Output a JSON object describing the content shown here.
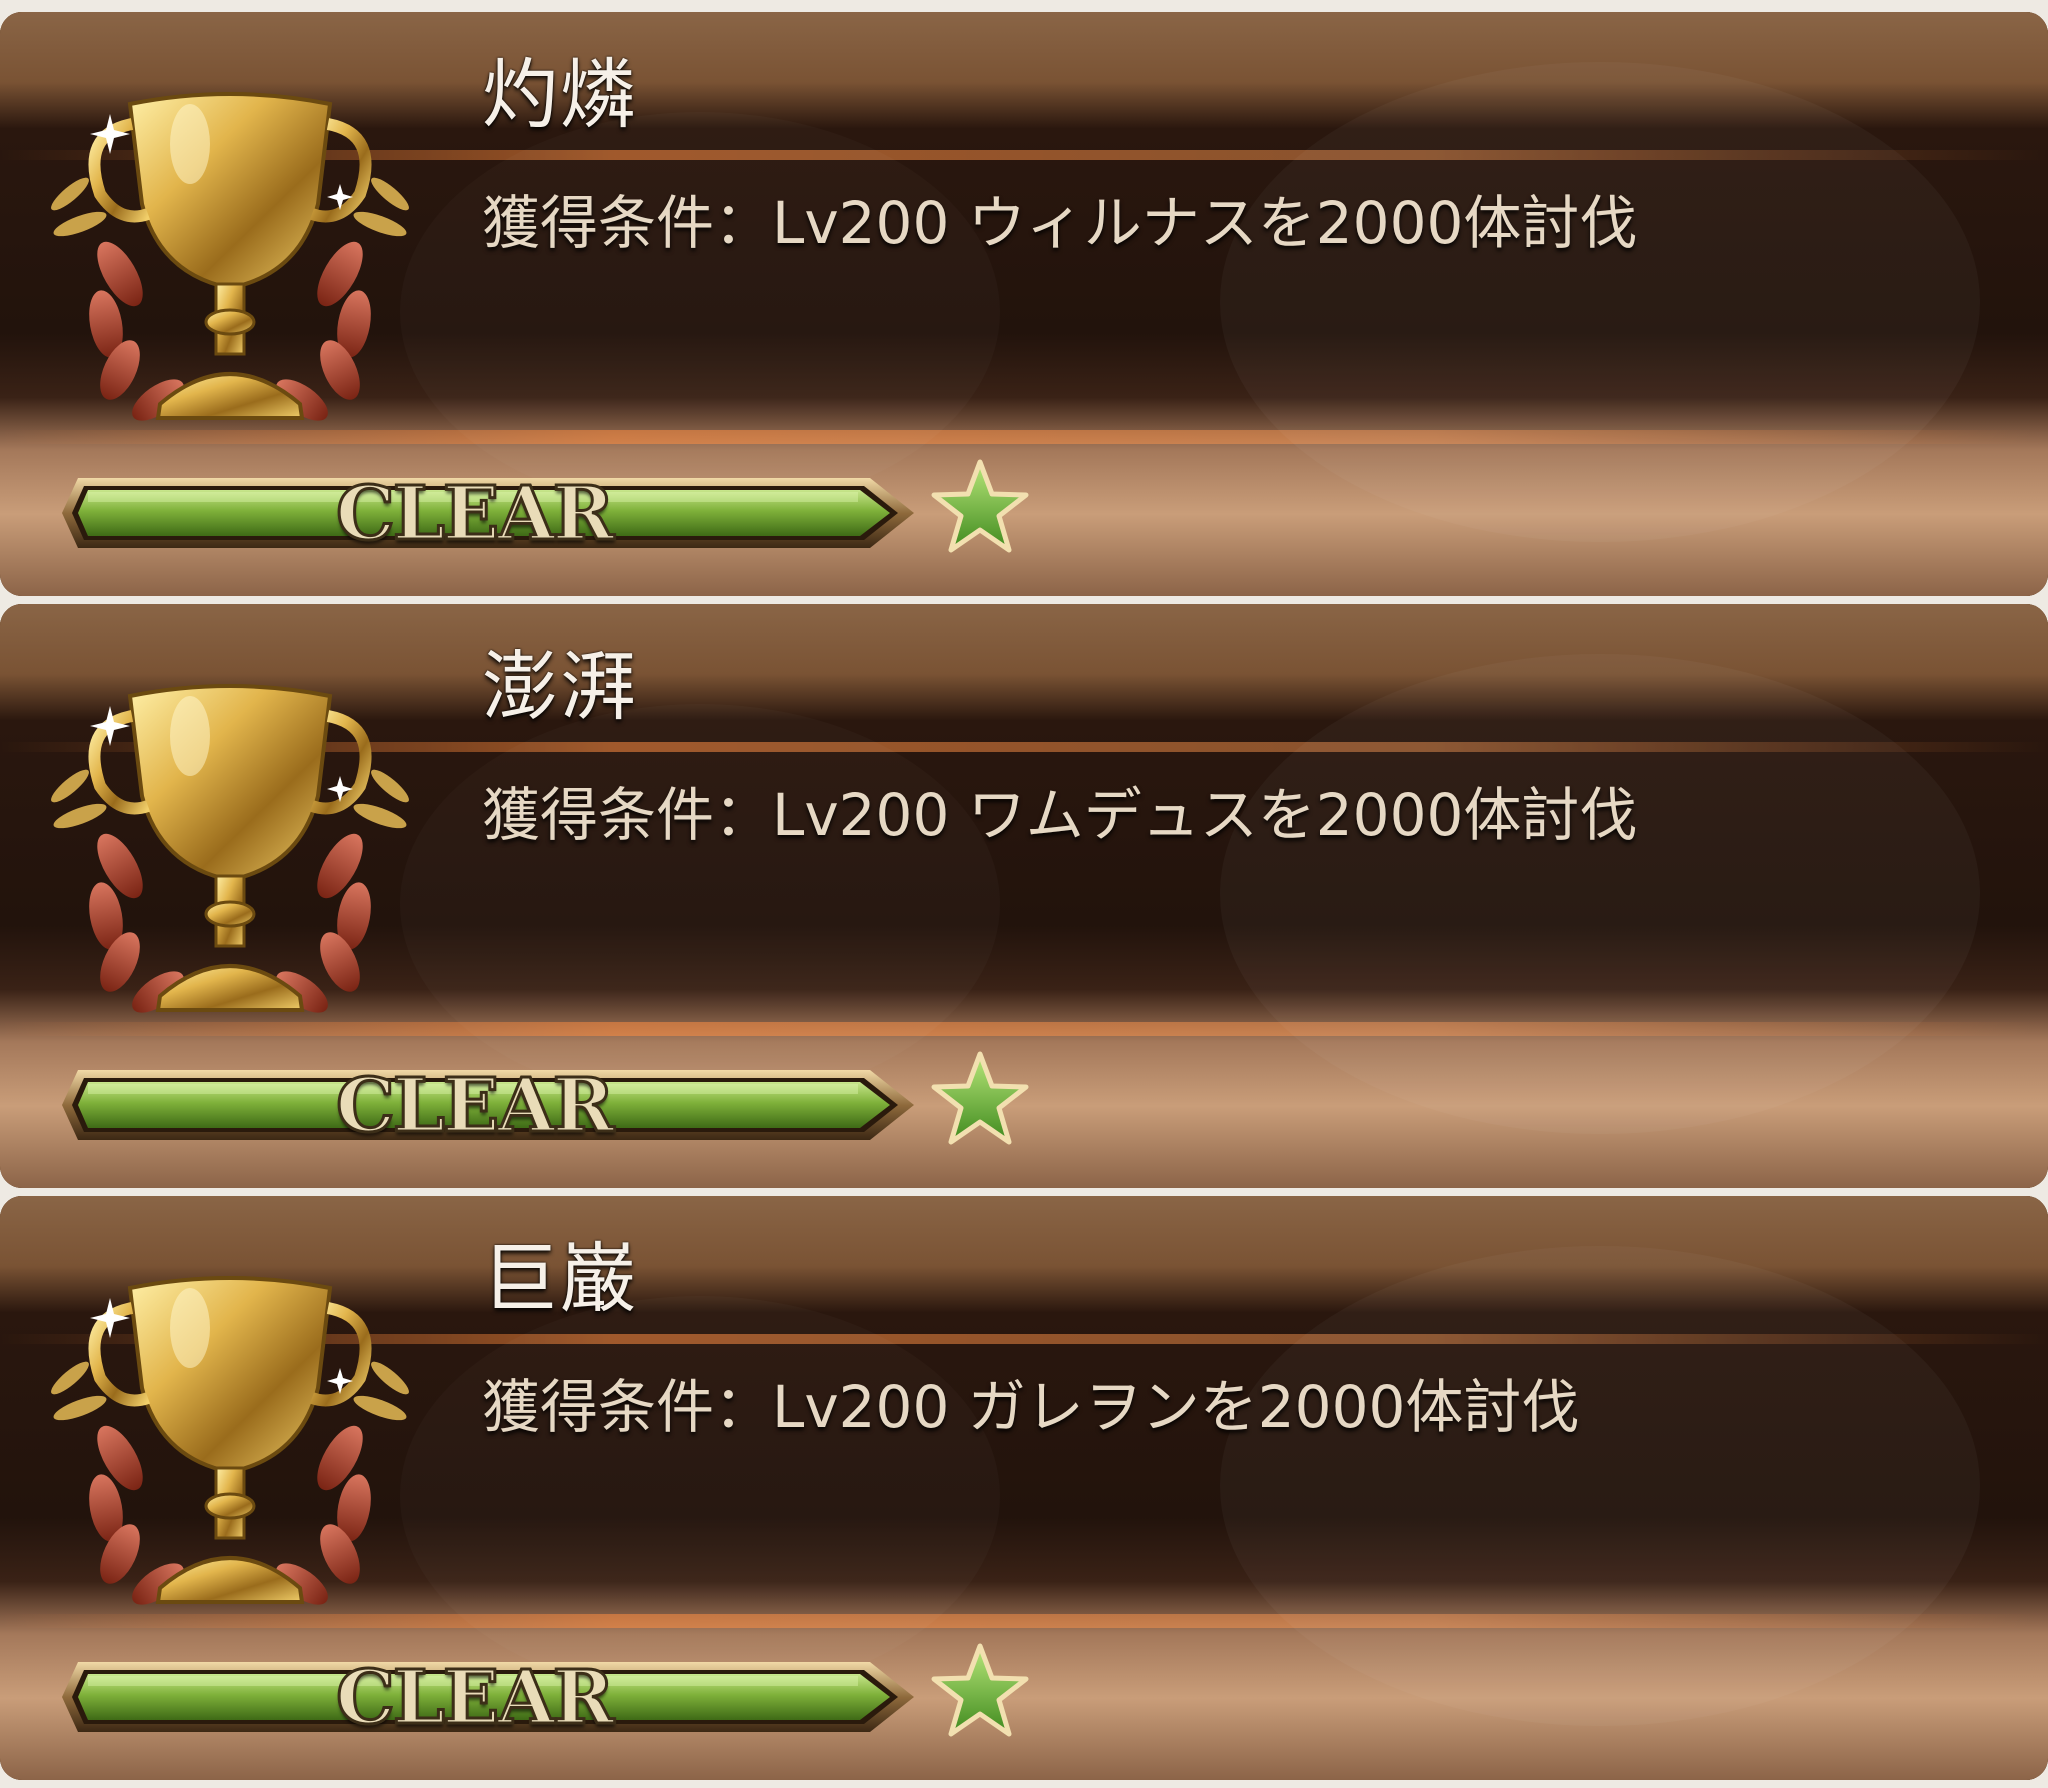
{
  "achievements": [
    {
      "title": "灼燐",
      "condition": "獲得条件：Lv200 ウィルナスを2000体討伐",
      "progress_fraction": 1.0,
      "status_label": "CLEAR",
      "stars": 1,
      "icon": "gold-trophy-icon"
    },
    {
      "title": "澎湃",
      "condition": "獲得条件：Lv200 ワムデュスを2000体討伐",
      "progress_fraction": 1.0,
      "status_label": "CLEAR",
      "stars": 1,
      "icon": "gold-trophy-icon"
    },
    {
      "title": "巨巌",
      "condition": "獲得条件：Lv200 ガレヲンを2000体討伐",
      "progress_fraction": 1.0,
      "status_label": "CLEAR",
      "stars": 1,
      "icon": "gold-trophy-icon"
    }
  ],
  "colors": {
    "bar_fill": "#7fb13a",
    "star_fill": "#5fa02c",
    "gold": "#d8ad4a"
  }
}
